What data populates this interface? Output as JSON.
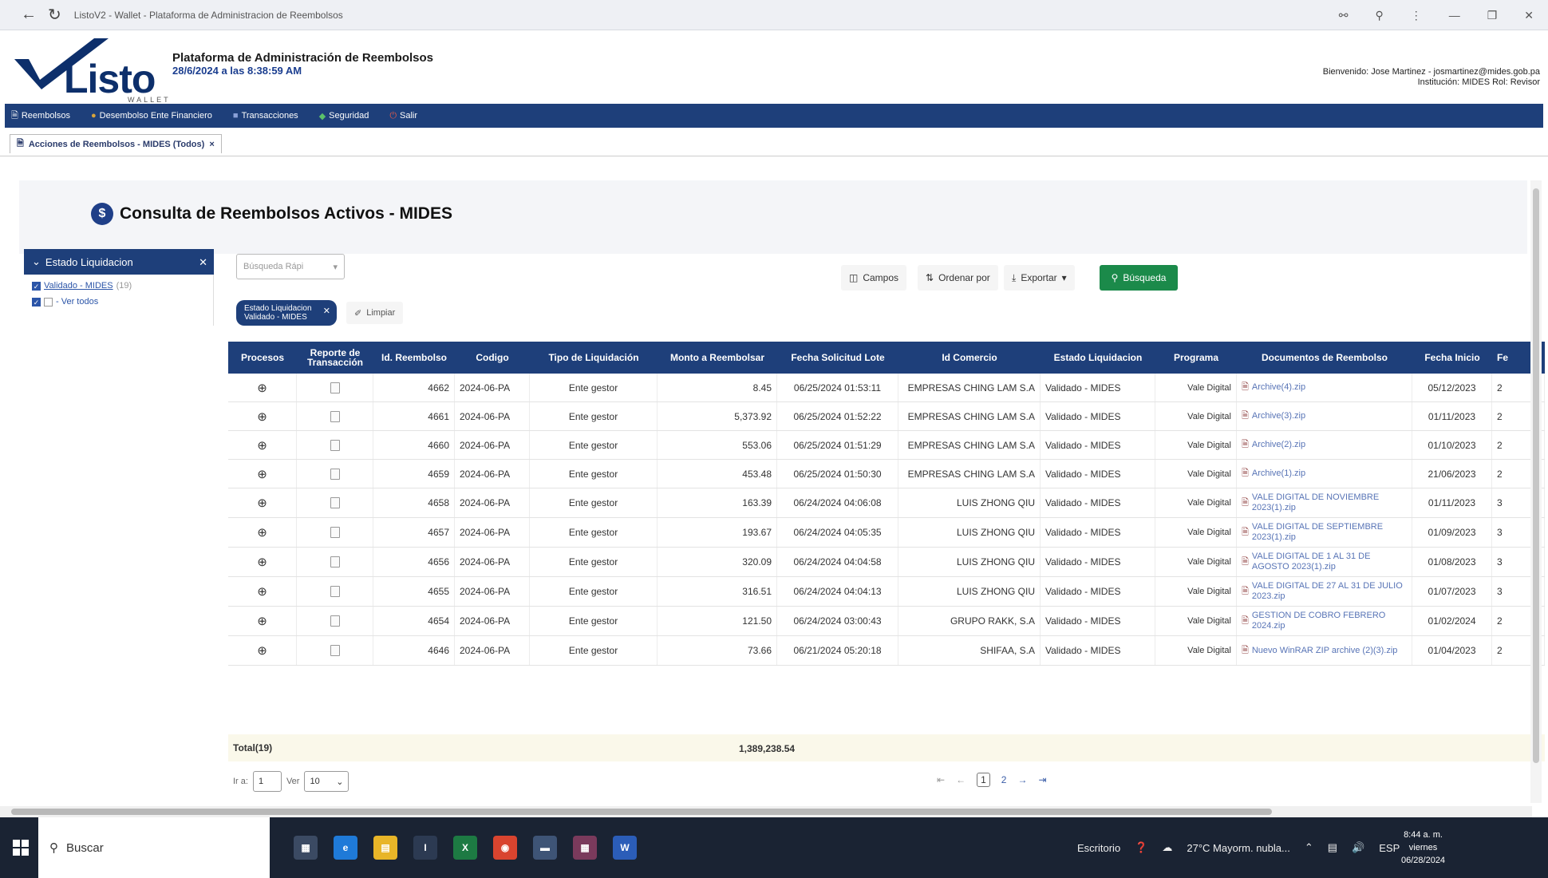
{
  "browser": {
    "title": "ListoV2 - Wallet - Plataforma de Administracion de Reembolsos",
    "icons": [
      "back-icon",
      "refresh-icon",
      "key-icon",
      "zoom-icon",
      "more-icon",
      "minimize-icon",
      "restore-icon",
      "close-icon"
    ]
  },
  "header": {
    "logo_text": "Listo",
    "logo_sub": "WALLET",
    "platform_title": "Plataforma de Administración de Reembolsos",
    "platform_date": "28/6/2024 a las 8:38:59 AM",
    "welcome_line1": "Bienvenido: Jose Martinez - josmartinez@mides.gob.pa",
    "welcome_line2": "Institución: MIDES Rol: Revisor"
  },
  "menu": [
    {
      "label": "Reembolsos",
      "icon": "document-icon"
    },
    {
      "label": "Desembolso Ente Financiero",
      "icon": "bank-icon"
    },
    {
      "label": "Transacciones",
      "icon": "transactions-icon"
    },
    {
      "label": "Seguridad",
      "icon": "security-icon"
    },
    {
      "label": "Salir",
      "icon": "exit-icon"
    }
  ],
  "tab": {
    "label": "Acciones de Reembolsos - MIDES (Todos)",
    "close": "×"
  },
  "page": {
    "title": "Consulta de Reembolsos Activos - MIDES",
    "title_icon": "$"
  },
  "filter": {
    "header": "Estado Liquidacion",
    "options": [
      {
        "label": "Validado - MIDES",
        "count": "(19)",
        "checked": true
      },
      {
        "label": "- Ver todos",
        "checked": true
      }
    ]
  },
  "toolbar": {
    "quick_search_placeholder": "Búsqueda Rápi",
    "campos": "Campos",
    "ordenar": "Ordenar por",
    "exportar": "Exportar",
    "busqueda": "Búsqueda",
    "chip_line1": "Estado Liquidacion",
    "chip_line2": "Validado - MIDES",
    "limpiar": "Limpiar"
  },
  "table": {
    "headers": {
      "procesos": "Procesos",
      "reporte": "Reporte de Transacción",
      "id": "Id. Reembolso",
      "codigo": "Codigo",
      "tipo": "Tipo de Liquidación",
      "monto": "Monto a Reembolsar",
      "fecha": "Fecha Solicitud Lote",
      "comercio": "Id Comercio",
      "estado": "Estado Liquidacion",
      "programa": "Programa",
      "documentos": "Documentos de Reembolso",
      "inicio": "Fecha Inicio",
      "fe": "Fe"
    },
    "rows": [
      {
        "id": "4662",
        "codigo": "2024-06-PA",
        "tipo": "Ente gestor",
        "monto": "8.45",
        "fecha": "06/25/2024 01:53:11",
        "comercio": "EMPRESAS CHING LAM S.A",
        "estado": "Validado - MIDES",
        "programa": "Vale Digital",
        "doc": "Archive(4).zip",
        "inicio": "05/12/2023",
        "fe": "2"
      },
      {
        "id": "4661",
        "codigo": "2024-06-PA",
        "tipo": "Ente gestor",
        "monto": "5,373.92",
        "fecha": "06/25/2024 01:52:22",
        "comercio": "EMPRESAS CHING LAM S.A",
        "estado": "Validado - MIDES",
        "programa": "Vale Digital",
        "doc": "Archive(3).zip",
        "inicio": "01/11/2023",
        "fe": "2"
      },
      {
        "id": "4660",
        "codigo": "2024-06-PA",
        "tipo": "Ente gestor",
        "monto": "553.06",
        "fecha": "06/25/2024 01:51:29",
        "comercio": "EMPRESAS CHING LAM S.A",
        "estado": "Validado - MIDES",
        "programa": "Vale Digital",
        "doc": "Archive(2).zip",
        "inicio": "01/10/2023",
        "fe": "2"
      },
      {
        "id": "4659",
        "codigo": "2024-06-PA",
        "tipo": "Ente gestor",
        "monto": "453.48",
        "fecha": "06/25/2024 01:50:30",
        "comercio": "EMPRESAS CHING LAM S.A",
        "estado": "Validado - MIDES",
        "programa": "Vale Digital",
        "doc": "Archive(1).zip",
        "inicio": "21/06/2023",
        "fe": "2"
      },
      {
        "id": "4658",
        "codigo": "2024-06-PA",
        "tipo": "Ente gestor",
        "monto": "163.39",
        "fecha": "06/24/2024 04:06:08",
        "comercio": "LUIS ZHONG QIU",
        "estado": "Validado - MIDES",
        "programa": "Vale Digital",
        "doc": "VALE DIGITAL DE NOVIEMBRE 2023(1).zip",
        "inicio": "01/11/2023",
        "fe": "3"
      },
      {
        "id": "4657",
        "codigo": "2024-06-PA",
        "tipo": "Ente gestor",
        "monto": "193.67",
        "fecha": "06/24/2024 04:05:35",
        "comercio": "LUIS ZHONG QIU",
        "estado": "Validado - MIDES",
        "programa": "Vale Digital",
        "doc": "VALE DIGITAL DE SEPTIEMBRE 2023(1).zip",
        "inicio": "01/09/2023",
        "fe": "3"
      },
      {
        "id": "4656",
        "codigo": "2024-06-PA",
        "tipo": "Ente gestor",
        "monto": "320.09",
        "fecha": "06/24/2024 04:04:58",
        "comercio": "LUIS ZHONG QIU",
        "estado": "Validado - MIDES",
        "programa": "Vale Digital",
        "doc": "VALE DIGITAL DE 1 AL 31 DE AGOSTO 2023(1).zip",
        "inicio": "01/08/2023",
        "fe": "3"
      },
      {
        "id": "4655",
        "codigo": "2024-06-PA",
        "tipo": "Ente gestor",
        "monto": "316.51",
        "fecha": "06/24/2024 04:04:13",
        "comercio": "LUIS ZHONG QIU",
        "estado": "Validado - MIDES",
        "programa": "Vale Digital",
        "doc": "VALE DIGITAL DE 27 AL 31 DE JULIO 2023.zip",
        "inicio": "01/07/2023",
        "fe": "3"
      },
      {
        "id": "4654",
        "codigo": "2024-06-PA",
        "tipo": "Ente gestor",
        "monto": "121.50",
        "fecha": "06/24/2024 03:00:43",
        "comercio": "GRUPO RAKK, S.A",
        "estado": "Validado - MIDES",
        "programa": "Vale Digital",
        "doc": "GESTION DE COBRO FEBRERO 2024.zip",
        "inicio": "01/02/2024",
        "fe": "2"
      },
      {
        "id": "4646",
        "codigo": "2024-06-PA",
        "tipo": "Ente gestor",
        "monto": "73.66",
        "fecha": "06/21/2024 05:20:18",
        "comercio": "SHIFAA, S.A",
        "estado": "Validado - MIDES",
        "programa": "Vale Digital",
        "doc": "Nuevo WinRAR ZIP archive (2)(3).zip",
        "inicio": "01/04/2023",
        "fe": "2"
      }
    ],
    "total_label": "Total(19)",
    "total_value": "1,389,238.54"
  },
  "pager": {
    "ira_label": "Ir a:",
    "ira_value": "1",
    "ver_label": "Ver",
    "ver_value": "10",
    "pages": [
      "1",
      "2"
    ],
    "first": "⇤",
    "prev": "←",
    "next": "→",
    "last": "⇥"
  },
  "taskbar": {
    "search": "Buscar",
    "desktop": "Escritorio",
    "weather": "27°C  Mayorm. nubla...",
    "lang": "ESP",
    "time": "8:44 a. m.",
    "day": "viernes",
    "date": "06/28/2024"
  },
  "colors": {
    "brand_navy": "#1e3f7a",
    "search_green": "#1b8a4a",
    "link_blue": "#5874b6"
  }
}
